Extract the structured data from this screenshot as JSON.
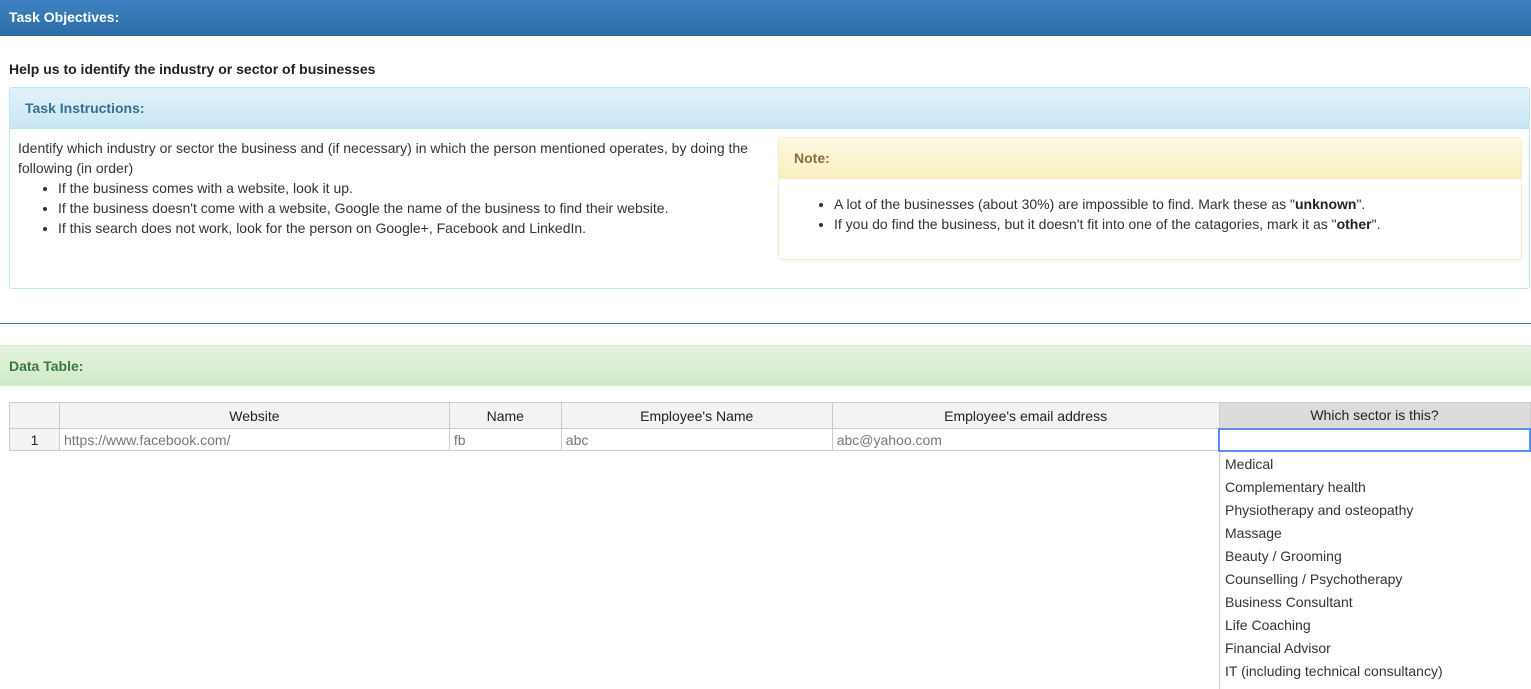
{
  "objectives": {
    "title": "Task Objectives:",
    "text": "Help us to identify the industry or sector of businesses"
  },
  "instructions": {
    "title": "Task Instructions:",
    "intro": "Identify which industry or sector the business and (if necessary) in which the person mentioned operates, by doing the following (in order)",
    "steps": [
      "If the business comes with a website, look it up.",
      "If the business doesn't come with a website, Google the name of the business to find their website.",
      "If this search does not work, look for the person on Google+, Facebook and LinkedIn."
    ]
  },
  "note": {
    "title": "Note:",
    "item1_pre": "A lot of the businesses (about 30%) are impossible to find. Mark these as \"",
    "item1_bold": "unknown",
    "item1_post": "\".",
    "item2_pre": "If you do find the business, but it doesn't fit into one of the catagories, mark it as \"",
    "item2_bold": "other",
    "item2_post": "\"."
  },
  "data_table": {
    "title": "Data Table:",
    "columns": [
      "Website",
      "Name",
      "Employee's Name",
      "Employee's email address",
      "Which sector is this?"
    ],
    "rows": [
      {
        "num": "1",
        "website": "https://www.facebook.com/",
        "name": "fb",
        "employee_name": "abc",
        "email": "abc@yahoo.com",
        "sector": ""
      }
    ]
  },
  "sector_options": [
    "Medical",
    "Complementary health",
    "Physiotherapy and osteopathy",
    "Massage",
    "Beauty / Grooming",
    "Counselling / Psychotherapy",
    "Business Consultant",
    "Life Coaching",
    "Financial Advisor",
    "IT (including technical consultancy)"
  ],
  "colors": {
    "primary": "#2f6ea8",
    "info": "#31708f",
    "warning": "#8a6d3b",
    "success": "#3c763d",
    "active_cell": "#5292f7"
  }
}
